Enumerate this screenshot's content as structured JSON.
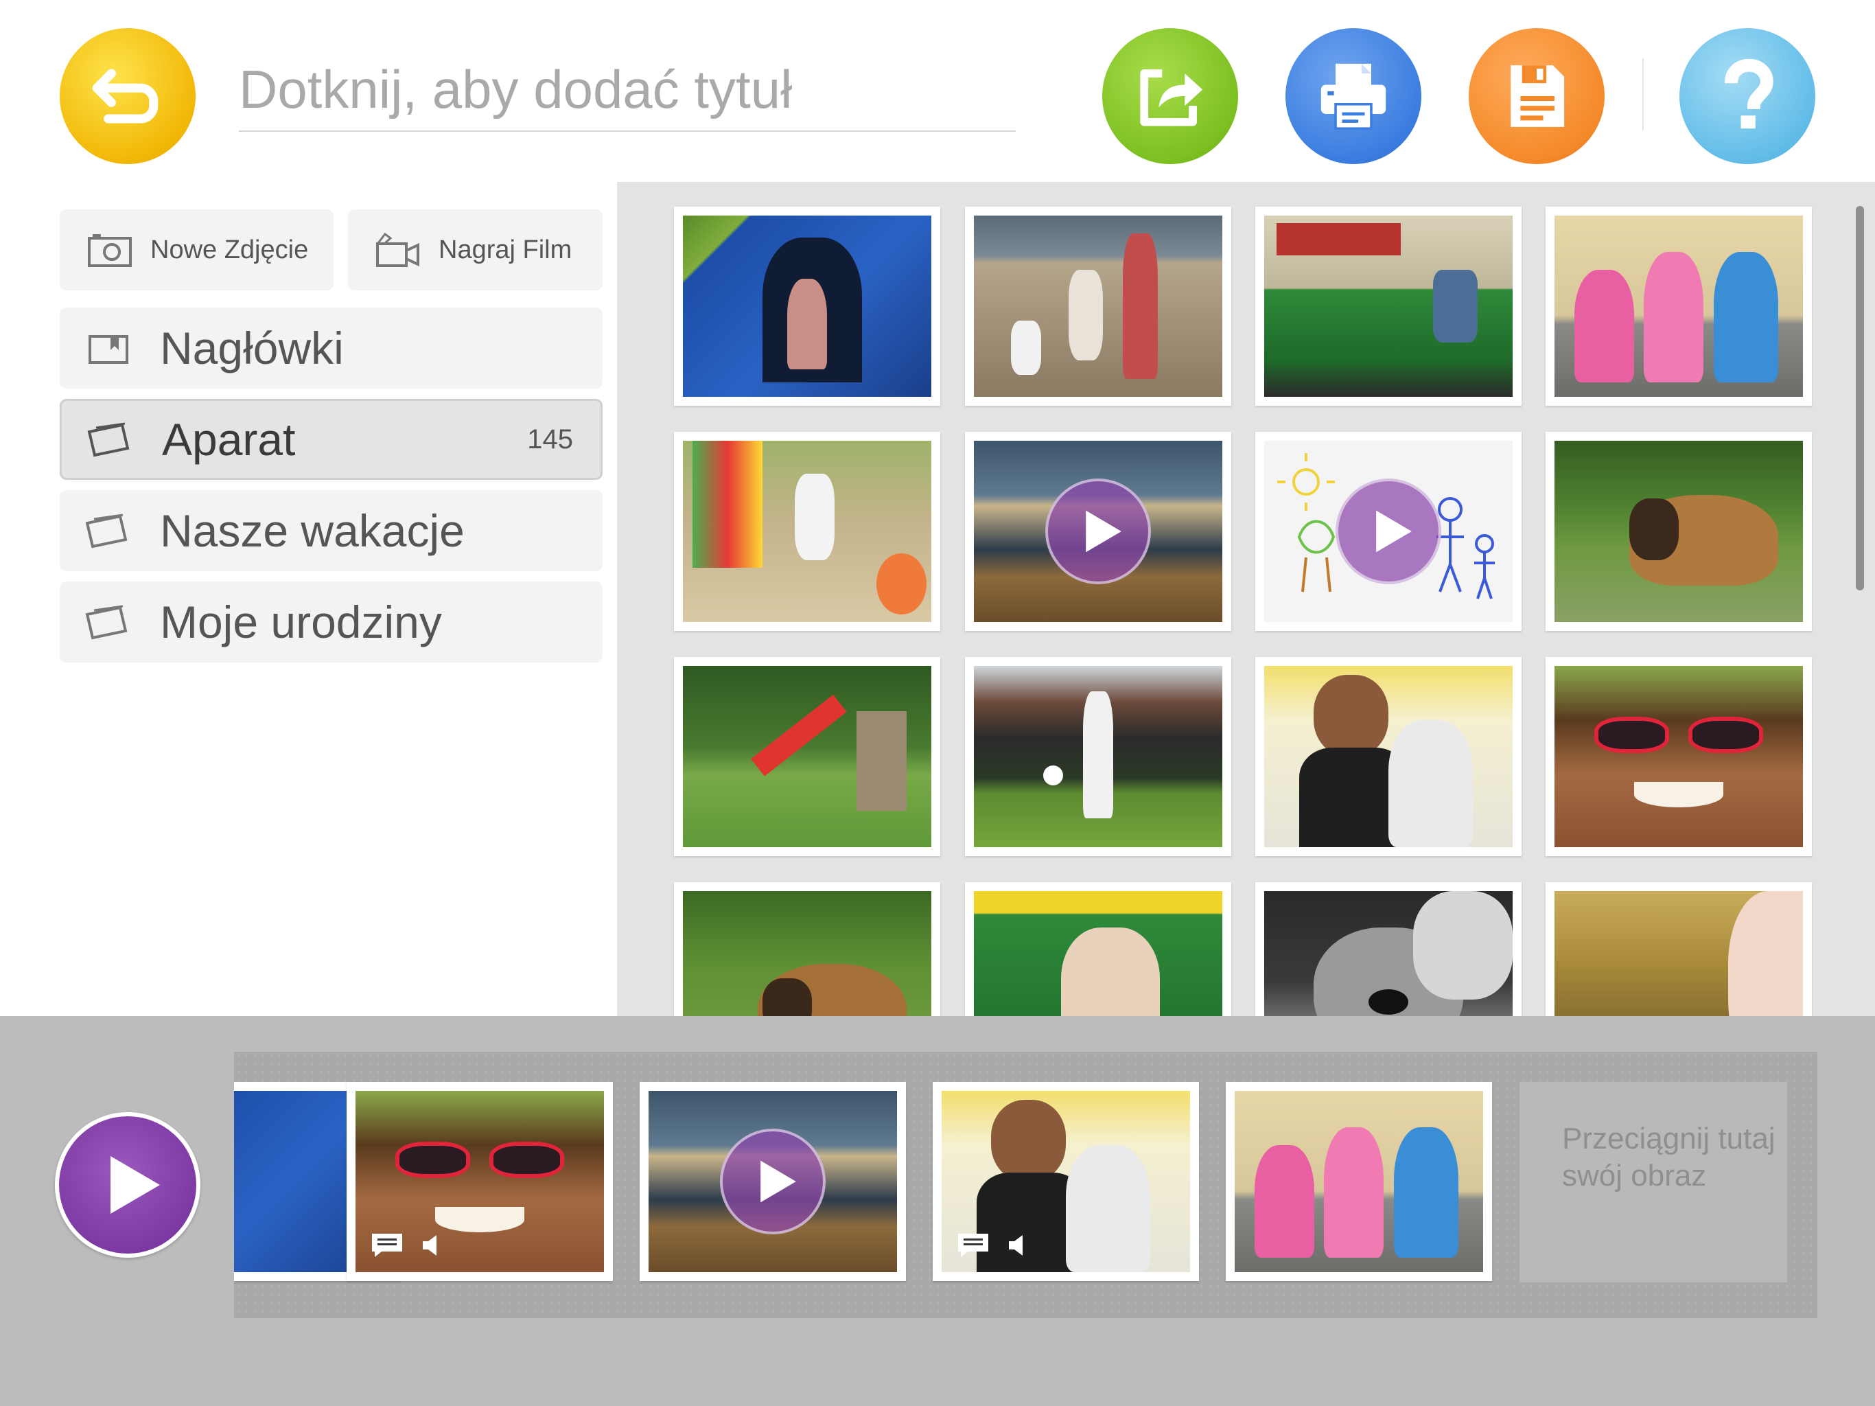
{
  "header": {
    "title_placeholder": "Dotknij, aby dodać tytuł",
    "title_value": ""
  },
  "toolbar": {
    "back_icon": "back-arrow-icon",
    "share_icon": "share-export-icon",
    "print_icon": "printer-icon",
    "save_icon": "save-floppy-icon",
    "help_icon": "question-mark-icon",
    "colors": {
      "back": "#f2b807",
      "share": "#7cc021",
      "print": "#3b7de0",
      "save": "#f48a2a",
      "help": "#62bde8",
      "play": "#7d3aa3"
    }
  },
  "sidebar": {
    "new_photo_label": "Nowe Zdjęcie",
    "record_film_label": "Nagraj Film",
    "albums": [
      {
        "label": "Nagłówki",
        "count": "",
        "icon": "headings-icon",
        "selected": false
      },
      {
        "label": "Aparat",
        "count": "145",
        "icon": "photo-stack-icon",
        "selected": true
      },
      {
        "label": "Nasze wakacje",
        "count": "",
        "icon": "photo-stack-icon",
        "selected": false
      },
      {
        "label": "Moje urodziny",
        "count": "",
        "icon": "photo-stack-icon",
        "selected": false
      }
    ]
  },
  "grid": {
    "items": [
      {
        "subject": "child-in-tent",
        "video": false
      },
      {
        "subject": "beach-family",
        "video": false
      },
      {
        "subject": "toy-train",
        "video": false
      },
      {
        "subject": "three-children-on-steps",
        "video": false
      },
      {
        "subject": "child-on-swing",
        "video": false
      },
      {
        "subject": "sea-waves",
        "video": true
      },
      {
        "subject": "child-drawing",
        "video": true
      },
      {
        "subject": "dog-on-grass",
        "video": false
      },
      {
        "subject": "garden-slide",
        "video": false
      },
      {
        "subject": "football-in-garden",
        "video": false
      },
      {
        "subject": "man-with-child",
        "video": false
      },
      {
        "subject": "child-with-sunglasses",
        "video": false
      },
      {
        "subject": "dog-in-grass",
        "video": false
      },
      {
        "subject": "children-in-train",
        "video": false
      },
      {
        "subject": "schnauzer-dog",
        "video": false
      },
      {
        "subject": "baby-and-box",
        "video": false
      }
    ]
  },
  "strip": {
    "items": [
      {
        "subject": "child-in-tent",
        "video": false,
        "has_caption": false
      },
      {
        "subject": "child-with-sunglasses",
        "video": false,
        "has_caption": true
      },
      {
        "subject": "sea-waves",
        "video": true,
        "has_caption": false
      },
      {
        "subject": "man-with-child",
        "video": false,
        "has_caption": true
      },
      {
        "subject": "three-children-on-steps",
        "video": false,
        "has_caption": false
      }
    ],
    "drop_text": "Przeciągnij tutaj swój obraz"
  }
}
